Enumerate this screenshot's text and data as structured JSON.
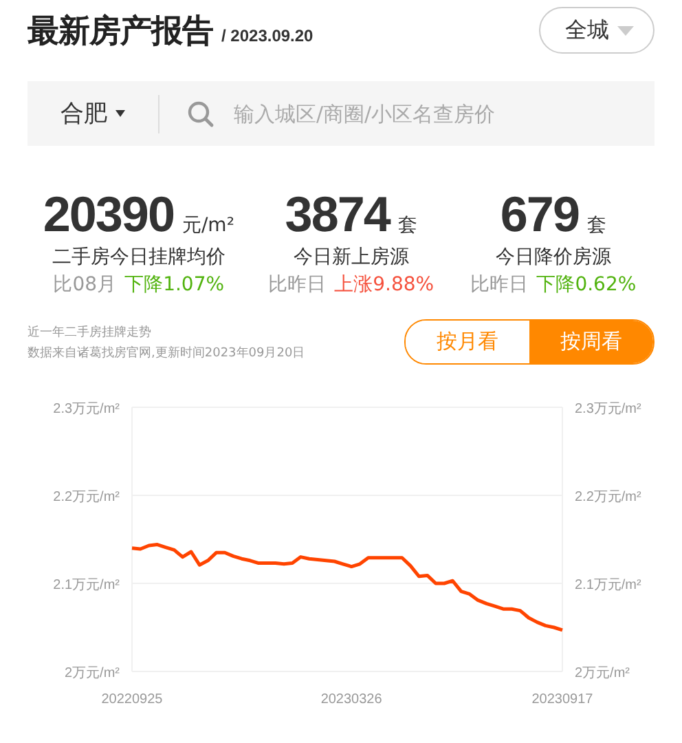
{
  "header": {
    "title": "最新房产报告",
    "date": "/ 2023.09.20",
    "scope_button": "全城"
  },
  "search": {
    "city": "合肥",
    "placeholder": "输入城区/商圈/小区名查房价"
  },
  "stats": [
    {
      "value": "20390",
      "unit": "元/m²",
      "label": "二手房今日挂牌均价",
      "compare": "比08月",
      "change": "下降1.07%",
      "kind": "down"
    },
    {
      "value": "3874",
      "unit": "套",
      "label": "今日新上房源",
      "compare": "比昨日",
      "change": "上涨9.88%",
      "kind": "up"
    },
    {
      "value": "679",
      "unit": "套",
      "label": "今日降价房源",
      "compare": "比昨日",
      "change": "下降0.62%",
      "kind": "down"
    }
  ],
  "trend": {
    "title": "近一年二手房挂牌走势",
    "source": "数据来自诸葛找房官网,更新时间2023年09月20日",
    "toggles": [
      {
        "label": "按月看",
        "selected": false
      },
      {
        "label": "按周看",
        "selected": true
      }
    ],
    "chart_data": {
      "type": "line",
      "ylim": [
        2,
        2.3
      ],
      "yticks": [
        {
          "value": 2,
          "label": "2万元/m²"
        },
        {
          "value": 2.1,
          "label": "2.1万元/m²"
        },
        {
          "value": 2.2,
          "label": "2.2万元/m²"
        },
        {
          "value": 2.3,
          "label": "2.3万元/m²"
        }
      ],
      "categories": [
        "20220925",
        null,
        null,
        null,
        null,
        null,
        null,
        null,
        null,
        null,
        null,
        null,
        null,
        null,
        null,
        null,
        null,
        null,
        null,
        null,
        null,
        null,
        null,
        null,
        null,
        null,
        "20230326",
        null,
        null,
        null,
        null,
        null,
        null,
        null,
        null,
        null,
        null,
        null,
        null,
        null,
        null,
        null,
        null,
        null,
        null,
        null,
        null,
        null,
        null,
        null,
        null,
        "20230917"
      ],
      "series": [
        {
          "color": "#ff4400",
          "values": [
            2.14,
            2.139,
            2.143,
            2.144,
            2.141,
            2.138,
            2.13,
            2.136,
            2.121,
            2.126,
            2.135,
            2.135,
            2.131,
            2.128,
            2.126,
            2.123,
            2.123,
            2.123,
            2.122,
            2.123,
            2.13,
            2.128,
            2.127,
            2.126,
            2.125,
            2.122,
            2.119,
            2.122,
            2.129,
            2.129,
            2.129,
            2.129,
            2.129,
            2.12,
            2.108,
            2.109,
            2.1,
            2.1,
            2.103,
            2.091,
            2.088,
            2.081,
            2.077,
            2.074,
            2.071,
            2.071,
            2.069,
            2.061,
            2.056,
            2.052,
            2.05,
            2.047
          ]
        }
      ]
    }
  }
}
